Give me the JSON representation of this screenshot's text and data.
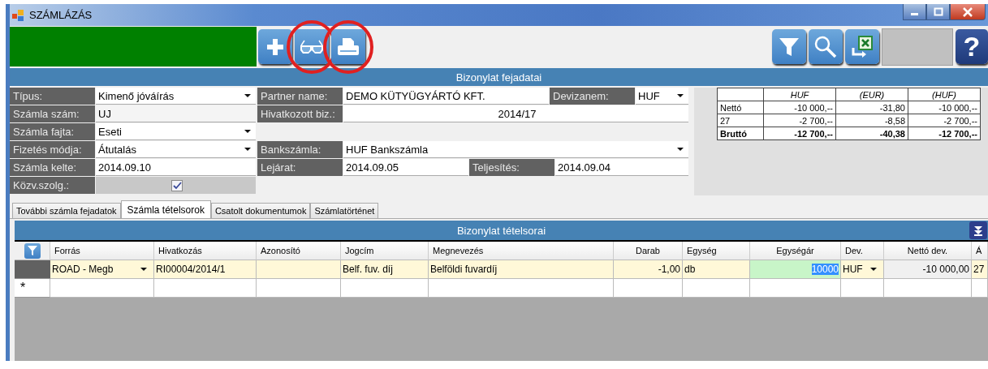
{
  "window": {
    "title": "SZÁMLÁZÁS"
  },
  "toolbar": {
    "buttons": [
      {
        "kind": "add",
        "circled": false
      },
      {
        "kind": "view",
        "circled": true
      },
      {
        "kind": "print",
        "circled": true
      }
    ],
    "right_buttons": [
      {
        "kind": "filter"
      },
      {
        "kind": "search"
      },
      {
        "kind": "excel"
      },
      {
        "kind": "blank"
      },
      {
        "kind": "help",
        "label": "?"
      }
    ]
  },
  "header_bar": {
    "title": "Bizonylat fejadatai"
  },
  "form": {
    "rows": [
      {
        "left": {
          "label": "Típus:",
          "value": "Kimenő jóváírás",
          "kind": "dropdown"
        },
        "right": [
          {
            "label": "Partner name:",
            "value": "DEMO KÜTYÜGYÁRTÓ KFT.",
            "kind": "text"
          },
          {
            "label": "Devizanem:",
            "value": "HUF",
            "kind": "dropdown"
          }
        ]
      },
      {
        "left": {
          "label": "Számla szám:",
          "value": "UJ",
          "kind": "readonly"
        },
        "right": [
          {
            "label": "Hivatkozott biz.:",
            "value": "2014/17",
            "kind": "centered"
          }
        ]
      },
      {
        "left": {
          "label": "Számla fajta:",
          "value": "Eseti",
          "kind": "dropdown"
        }
      },
      {
        "left": {
          "label": "Fizetés módja:",
          "value": "Átutalás",
          "kind": "dropdown"
        },
        "right": [
          {
            "label": "Bankszámla:",
            "value": "HUF Bankszámla",
            "kind": "dropdown"
          }
        ]
      },
      {
        "left": {
          "label": "Számla kelte:",
          "value": "2014.09.10",
          "kind": "text"
        },
        "right": [
          {
            "label": "Lejárat:",
            "value": "2014.09.05",
            "kind": "text"
          },
          {
            "label": "Teljesítés:",
            "value": "2014.09.04",
            "kind": "text"
          }
        ]
      },
      {
        "left": {
          "label": "Közv.szolg.:",
          "kind": "checkbox",
          "checked": true
        }
      }
    ]
  },
  "summary": {
    "columns": [
      "HUF",
      "(EUR)",
      "(HUF)"
    ],
    "rows": [
      {
        "label": "Nettó",
        "values": [
          "-10 000,--",
          "-31,80",
          "-10 000,--"
        ],
        "bold": false
      },
      {
        "label": "27",
        "values": [
          "-2 700,--",
          "-8,58",
          "-2 700,--"
        ],
        "bold": false
      },
      {
        "label": "Bruttó",
        "values": [
          "-12 700,--",
          "-40,38",
          "-12 700,--"
        ],
        "bold": true
      }
    ]
  },
  "tabs": [
    {
      "label": "További számla fejadatok",
      "selected": false
    },
    {
      "label": "Számla tételsorok",
      "selected": true
    },
    {
      "label": "Csatolt dokumentumok",
      "selected": false
    },
    {
      "label": "Számlatörténet",
      "selected": false
    }
  ],
  "table": {
    "title": "Bizonylat tételsorai",
    "columns": [
      {
        "label": "Forrás",
        "kind": "text"
      },
      {
        "label": "Hivatkozás",
        "kind": "text"
      },
      {
        "label": "Azonosító",
        "kind": "center"
      },
      {
        "label": "Jogcím",
        "kind": "text"
      },
      {
        "label": "Megnevezés",
        "kind": "text"
      },
      {
        "label": "Darab",
        "kind": "number"
      },
      {
        "label": "Egység",
        "kind": "text"
      },
      {
        "label": "Egységár",
        "kind": "number"
      },
      {
        "label": "Dev.",
        "kind": "text"
      },
      {
        "label": "Nettó dev.",
        "kind": "number"
      },
      {
        "label": "Á",
        "kind": "text"
      }
    ],
    "rows": [
      {
        "cells": [
          {
            "value": "ROAD - Megb",
            "kind": "dropdown"
          },
          {
            "value": "RI00004/2014/1",
            "kind": "text"
          },
          {
            "kind": "text"
          },
          {
            "value": "Belf. fuv. díj",
            "kind": "text"
          },
          {
            "value": "Belföldi fuvardíj",
            "kind": "text"
          },
          {
            "value": "-1,00",
            "kind": "text"
          },
          {
            "value": "db",
            "kind": "text"
          },
          {
            "value": "10000",
            "kind": "editing"
          },
          {
            "value": "HUF",
            "kind": "dropdown"
          },
          {
            "value": "-10 000,00",
            "kind": "readonly"
          },
          {
            "value": "27",
            "kind": "text"
          }
        ]
      }
    ],
    "new_row_marker": "*"
  }
}
